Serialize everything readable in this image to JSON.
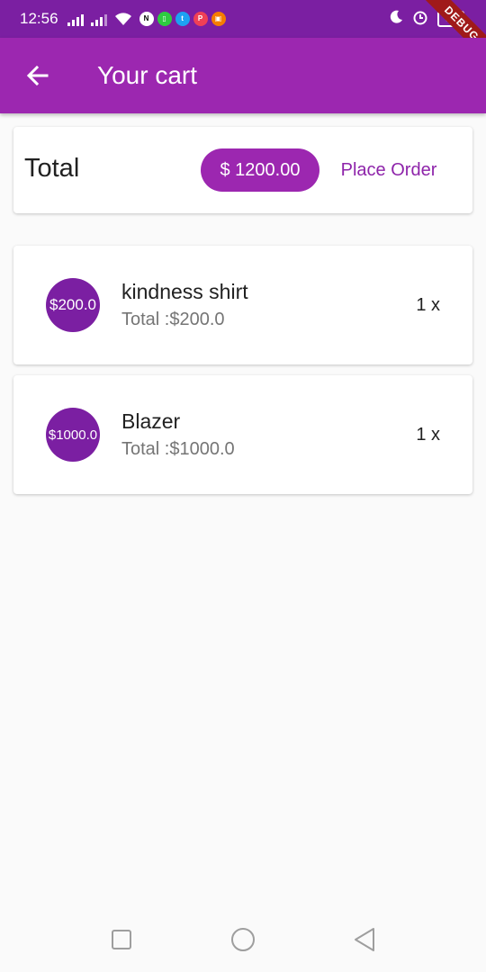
{
  "status_bar": {
    "time": "12:56",
    "battery": "84",
    "debug_label": "DEBUG",
    "notification_icons": [
      "nos-icon",
      "green-app-icon",
      "twitter-icon",
      "pocket-icon",
      "camera-app-icon"
    ]
  },
  "app_bar": {
    "title": "Your cart",
    "accent_color": "#9c27b0",
    "status_color": "#7b1fa2"
  },
  "summary": {
    "label": "Total",
    "amount": "$ 1200.00",
    "action": "Place Order"
  },
  "items": [
    {
      "avatar_text": "$200.0",
      "name": "kindness shirt",
      "total": "Total :$200.0",
      "qty": "1 x"
    },
    {
      "avatar_text": "$1000.0",
      "name": "Blazer",
      "total": "Total :$1000.0",
      "qty": "1 x"
    }
  ]
}
